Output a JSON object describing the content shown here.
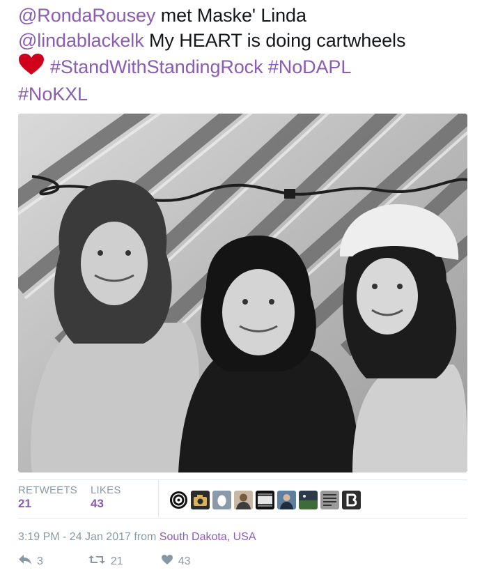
{
  "tweet": {
    "line1": {
      "mention": "@RondaRousey",
      "text": " met Maske' Linda"
    },
    "line2": {
      "mention": "@lindablackelk",
      "text": " My HEART is doing cartwheels"
    },
    "hashtags": [
      "#StandWithStandingRock",
      "#NoDAPL",
      "#NoKXL"
    ],
    "heart_icon": "red-heart-emoji"
  },
  "photo": {
    "description_icon": "photo"
  },
  "stats": {
    "retweets_label": "RETWEETS",
    "retweets_count": "21",
    "likes_label": "LIKES",
    "likes_count": "43"
  },
  "liker_avatars": [
    "spiral",
    "camera",
    "egg",
    "person",
    "film",
    "person-outdoor",
    "field",
    "text-image",
    "b-logo"
  ],
  "meta": {
    "time": "3:19 PM - 24 Jan 2017",
    "from": " from ",
    "place": "South Dakota, USA"
  },
  "actions": {
    "reply_count": "3",
    "retweet_count": "21",
    "like_count": "43"
  },
  "colors": {
    "link": "#8b5bb6",
    "muted": "#8899a6",
    "heart": "#d0021b"
  }
}
